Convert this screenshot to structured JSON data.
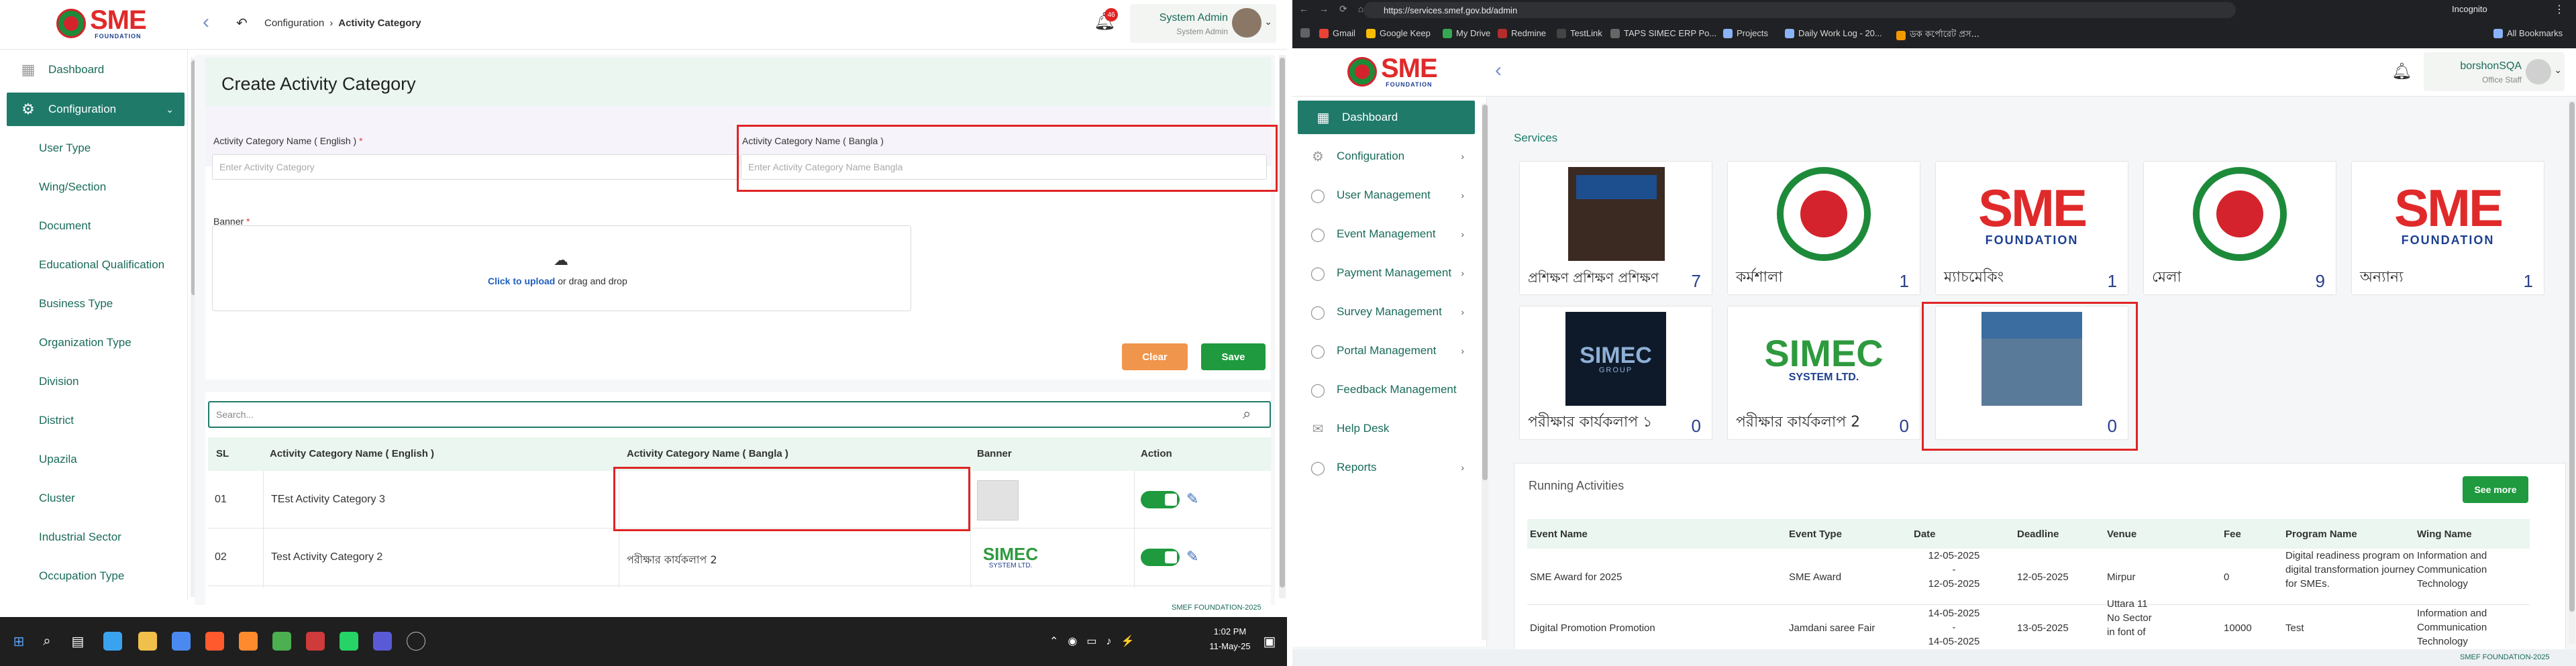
{
  "left_app": {
    "header": {
      "logo_text": "SME",
      "logo_sub": "FOUNDATION",
      "notification_count": "46",
      "user_name": "System Admin",
      "user_role": "System Admin",
      "breadcrumb": [
        "Configuration",
        "Activity Category"
      ]
    },
    "sidebar": {
      "dashboard": "Dashboard",
      "configuration": "Configuration",
      "sub_items": [
        "User Type",
        "Wing/Section",
        "Document",
        "Educational Qualification",
        "Business Type",
        "Organization Type",
        "Division",
        "District",
        "Upazila",
        "Cluster",
        "Industrial Sector",
        "Occupation Type"
      ]
    },
    "form": {
      "title": "Create Activity Category",
      "name_en_label": "Activity Category Name ( English )",
      "name_en_placeholder": "Enter Activity Category",
      "name_bn_label": "Activity Category Name ( Bangla )",
      "name_bn_placeholder": "Enter Activity Category Name Bangla",
      "banner_label": "Banner",
      "upload_link": "Click to upload",
      "upload_rest": "or drag and drop",
      "clear_label": "Clear",
      "save_label": "Save",
      "required_mark": "*"
    },
    "table": {
      "search_placeholder": "Search...",
      "headers": [
        "SL",
        "Activity Category Name ( English )",
        "Activity Category Name ( Bangla )",
        "Banner",
        "Action"
      ],
      "rows": [
        {
          "sl": "01",
          "name_en": "TEst Activity Category 3",
          "name_bn": ""
        },
        {
          "sl": "02",
          "name_en": "Test Activity Category 2",
          "name_bn": "পরীক্ষার কার্যকলাপ 2"
        }
      ]
    },
    "footer": "SMEF FOUNDATION-2025"
  },
  "taskbar": {
    "time": "1:02 PM",
    "date": "11-May-25"
  },
  "right_browser": {
    "url": "https://services.smef.gov.bd/admin",
    "profile": "Incognito",
    "bookmarks": [
      "Gmail",
      "Google Keep",
      "My Drive",
      "Redmine",
      "TestLink",
      "TAPS SIMEC ERP Po...",
      "Projects",
      "Daily Work Log - 20...",
      "ডক কর্পোরেট প্রস..."
    ],
    "all_bookmarks": "All Bookmarks",
    "header": {
      "user_name": "borshonSQA",
      "user_role": "Office Staff"
    },
    "sidebar": [
      "Dashboard",
      "Configuration",
      "User Management",
      "Event Management",
      "Payment Management",
      "Survey Management",
      "Portal Management",
      "Feedback Management",
      "Help Desk",
      "Reports"
    ],
    "services_title": "Services",
    "services": [
      {
        "name": "প্রশিক্ষণ প্রশিক্ষণ প্রশিক্ষণ",
        "count": "7"
      },
      {
        "name": "কর্মশালা",
        "count": "1"
      },
      {
        "name": "ম্যাচমেকিং",
        "count": "1"
      },
      {
        "name": "মেলা",
        "count": "9"
      },
      {
        "name": "অন্যান্য",
        "count": "1"
      },
      {
        "name": "পরীক্ষার কার্যকলাপ ১",
        "count": "0"
      },
      {
        "name": "পরীক্ষার কার্যকলাপ 2",
        "count": "0"
      },
      {
        "name": "",
        "count": "0"
      }
    ],
    "running": {
      "title": "Running Activities",
      "see_more": "See more",
      "headers": [
        "Event Name",
        "Event Type",
        "Date",
        "Deadline",
        "Venue",
        "Fee",
        "Program Name",
        "Wing Name"
      ],
      "rows": [
        {
          "event": "SME Award for 2025",
          "type": "SME Award",
          "date": "12-05-2025\n-\n12-05-2025",
          "deadline": "12-05-2025",
          "venue": "Mirpur",
          "fee": "0",
          "program": "Digital readiness program on digital transformation journey for SMEs.",
          "wing": "Information and Communication Technology"
        },
        {
          "event": "Digital Promotion Promotion",
          "type": "Jamdani saree Fair",
          "date": "14-05-2025\n-\n14-05-2025",
          "deadline": "13-05-2025",
          "venue": "Uttara 11\nNo Sector\nin font of",
          "fee": "10000",
          "program": "Test",
          "wing": "Information and Communication Technology"
        }
      ]
    },
    "footer": "SMEF FOUNDATION-2025"
  },
  "colors": {
    "brand_green": "#1f7a6a",
    "save_green": "#1f9a3e",
    "clear_orange": "#f0954c",
    "highlight_red": "#e02424",
    "link_blue": "#1f5fbf"
  }
}
